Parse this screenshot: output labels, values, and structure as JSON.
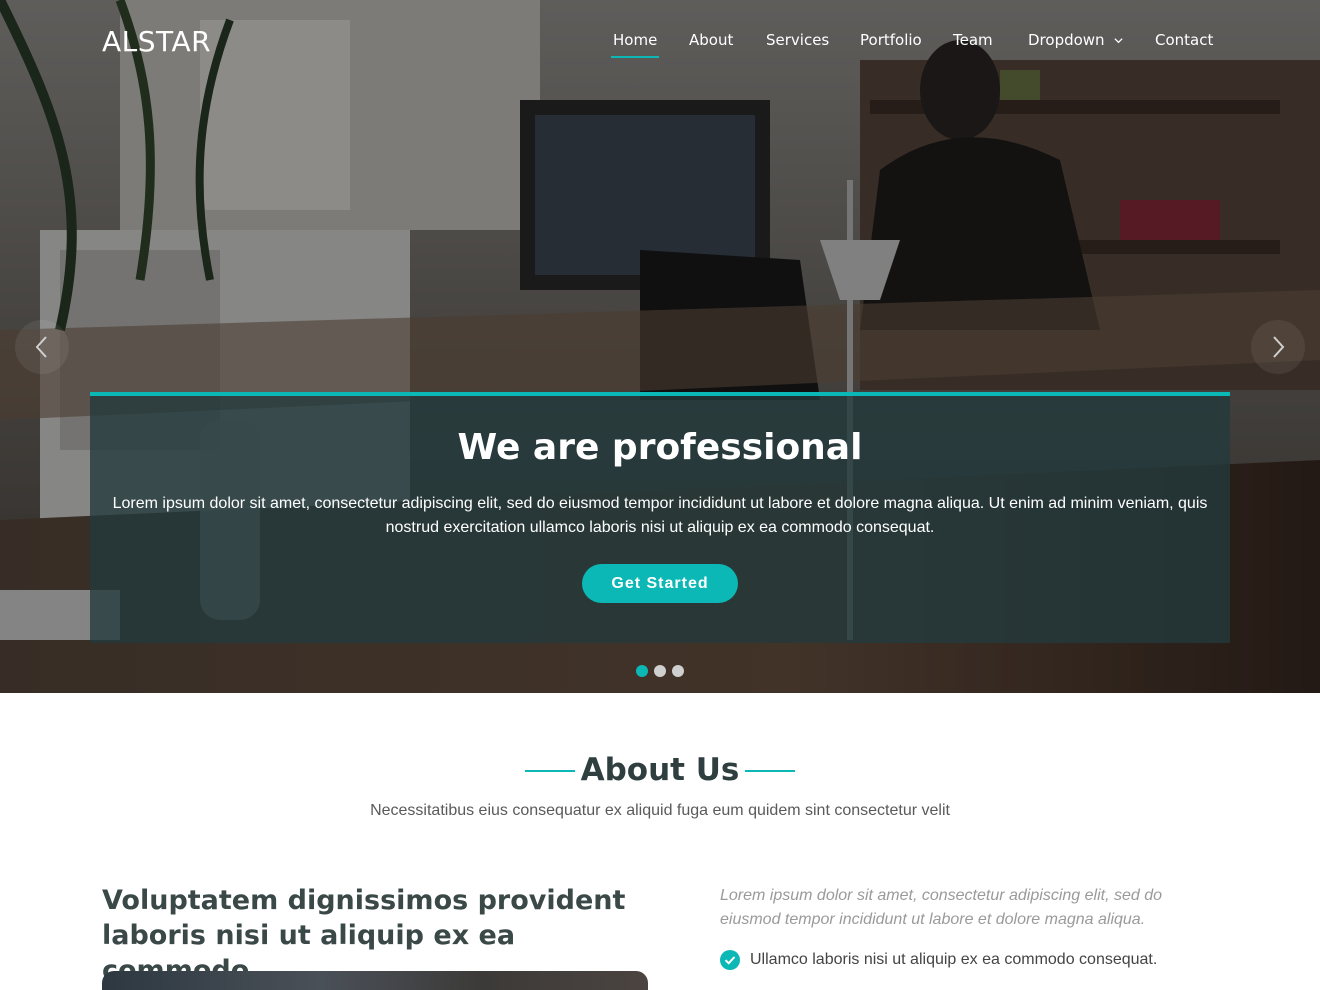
{
  "brand": {
    "name": "ALSTAR",
    "accent": "#0cb8b6"
  },
  "nav": {
    "items": [
      {
        "label": "Home",
        "active": true
      },
      {
        "label": "About"
      },
      {
        "label": "Services"
      },
      {
        "label": "Portfolio"
      },
      {
        "label": "Team"
      },
      {
        "label": "Dropdown",
        "icon": "chevron-down-icon"
      },
      {
        "label": "Contact"
      }
    ]
  },
  "hero": {
    "title": "We are professional",
    "text": "Lorem ipsum dolor sit amet, consectetur adipiscing elit, sed do eiusmod tempor incididunt ut labore et dolore magna aliqua. Ut enim ad minim veniam, quis nostrud exercitation ullamco laboris nisi ut aliquip ex ea commodo consequat.",
    "button": "Get Started",
    "prev_icon": "chevron-left-icon",
    "next_icon": "chevron-right-icon",
    "slides": 3,
    "active_slide": 1
  },
  "about": {
    "title": "About Us",
    "subtitle": "Necessitatibus eius consequatur ex aliquid fuga eum quidem sint consectetur velit",
    "heading": "Voluptatem dignissimos provident laboris nisi ut aliquip ex ea commodo",
    "lead": "Lorem ipsum dolor sit amet, consectetur adipiscing elit, sed do eiusmod tempor incididunt ut labore et dolore magna aliqua.",
    "checklist": [
      "Ullamco laboris nisi ut aliquip ex ea commodo consequat."
    ]
  }
}
